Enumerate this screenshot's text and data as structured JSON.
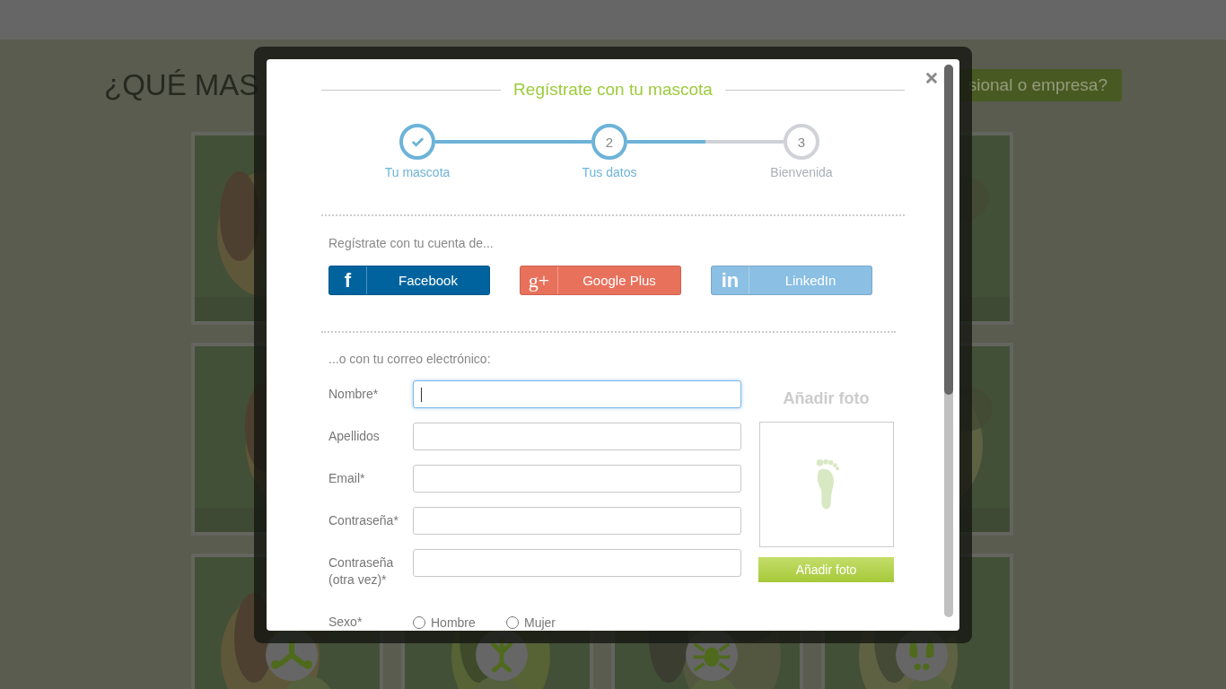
{
  "page": {
    "heading": "¿QUÉ MAS",
    "pro_button": "sional o empresa?"
  },
  "modal": {
    "title": "Regístrate con tu mascota",
    "steps": [
      {
        "label": "Tu mascota",
        "done": true,
        "active": false
      },
      {
        "label": "Tus datos",
        "number": "2",
        "done": false,
        "active": true
      },
      {
        "label": "Bienvenida",
        "number": "3",
        "done": false,
        "active": false
      }
    ],
    "connectors": [
      {
        "level": 1
      },
      {
        "level": 0.5
      }
    ],
    "social_prompt": "Regístrate con tu cuenta de...",
    "social_buttons": [
      {
        "kind": "facebook",
        "icon": "f",
        "label": "Facebook"
      },
      {
        "kind": "google",
        "icon": "g+",
        "label": "Google Plus"
      },
      {
        "kind": "linkedin",
        "icon": "in",
        "label": "LinkedIn"
      }
    ],
    "email_prompt": "...o con tu correo electrónico:",
    "fields": [
      {
        "label": "Nombre*",
        "focused": true
      },
      {
        "label": "Apellidos",
        "focused": false
      },
      {
        "label": "Email*",
        "focused": false
      },
      {
        "label": "Contraseña*",
        "focused": false
      },
      {
        "label": "Contraseña (otra vez)*",
        "focused": false
      }
    ],
    "photo": {
      "title": "Añadir foto",
      "button": "Añadir foto"
    },
    "gender": {
      "label": "Sexo*",
      "options": [
        {
          "label": "Hombre",
          "selected": false
        },
        {
          "label": "Mujer",
          "selected": false
        }
      ]
    }
  }
}
